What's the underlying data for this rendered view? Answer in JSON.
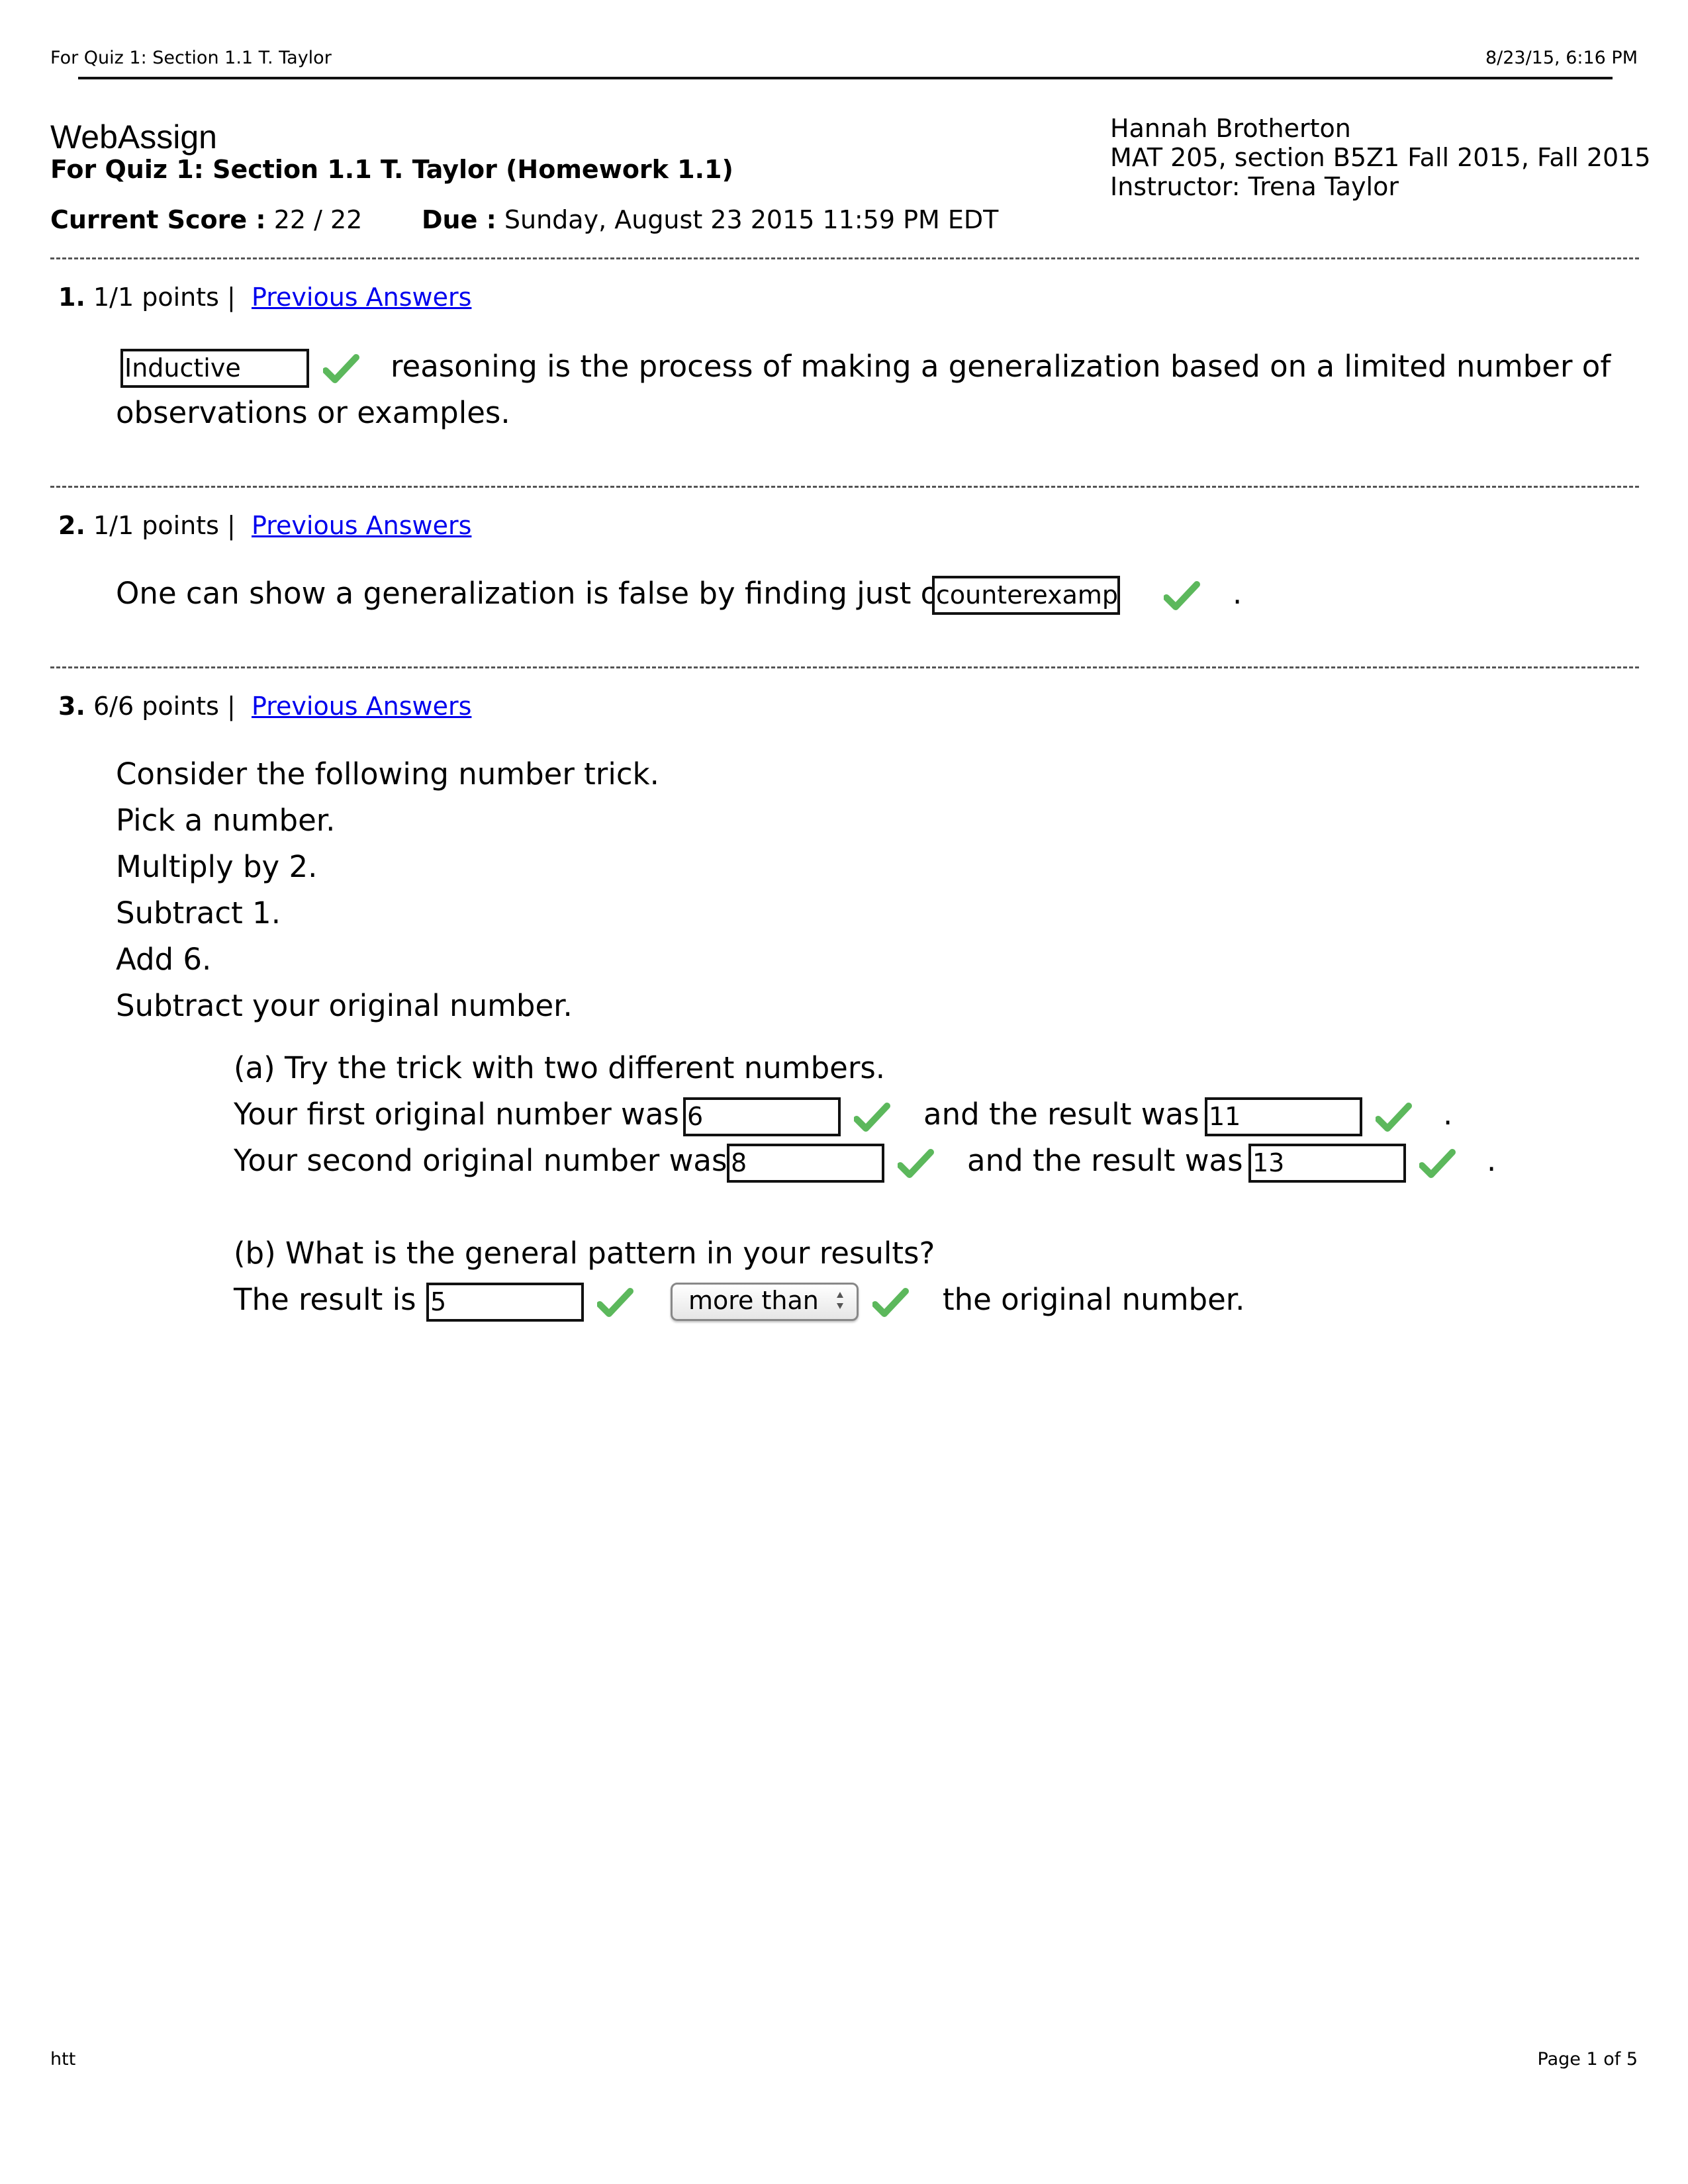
{
  "print_header": {
    "title": "For Quiz 1: Section 1.1 T. Taylor",
    "timestamp": "8/23/15, 6:16 PM"
  },
  "header": {
    "brand": "WebAssign",
    "assignment_title": "For Quiz 1: Section 1.1 T. Taylor (Homework 1.1)",
    "score_label": "Current Score :",
    "score_value": "22 / 22",
    "due_label": "Due :",
    "due_value": "Sunday, August 23 2015 11:59 PM EDT",
    "student_name": "Hannah Brotherton",
    "course": "MAT 205, section B5Z1 Fall 2015, Fall 2015",
    "instructor": "Instructor: Trena Taylor"
  },
  "questions": [
    {
      "number": "1.",
      "points": "1/1 points |",
      "link": "Previous Answers",
      "answer": "Inductive",
      "text_after": "reasoning is the process of making a generalization based on a limited number of",
      "text_line2": "observations or examples.",
      "correct": true
    },
    {
      "number": "2.",
      "points": "1/1 points |",
      "link": "Previous Answers",
      "text_before": "One can show a generalization is false by finding just one",
      "answer": "counterexample",
      "text_after": ".",
      "correct": true
    },
    {
      "number": "3.",
      "points": "6/6 points |",
      "link": "Previous Answers",
      "intro_lines": [
        "Consider the following number trick.",
        "Pick a number.",
        "Multiply by 2.",
        "Subtract 1.",
        "Add 6.",
        "Subtract your original number."
      ],
      "part_a": {
        "prompt": "(a) Try the trick with two different numbers.",
        "first_label": "Your first original number was",
        "first_value": "6",
        "first_result_label": "and the result was",
        "first_result_value": "11",
        "second_label": "Your second original number was",
        "second_value": "8",
        "second_result_label": "and the result was",
        "second_result_value": "13",
        "period": "."
      },
      "part_b": {
        "prompt": "(b) What is the general pattern in your results?",
        "label": "The result is",
        "value": "5",
        "select_value": "more than",
        "text_after": "the original number."
      }
    }
  ],
  "print_footer": {
    "left": "htt",
    "right": "Page 1 of 5"
  },
  "colors": {
    "link": "#0000ee",
    "check": "#5cb85c"
  }
}
